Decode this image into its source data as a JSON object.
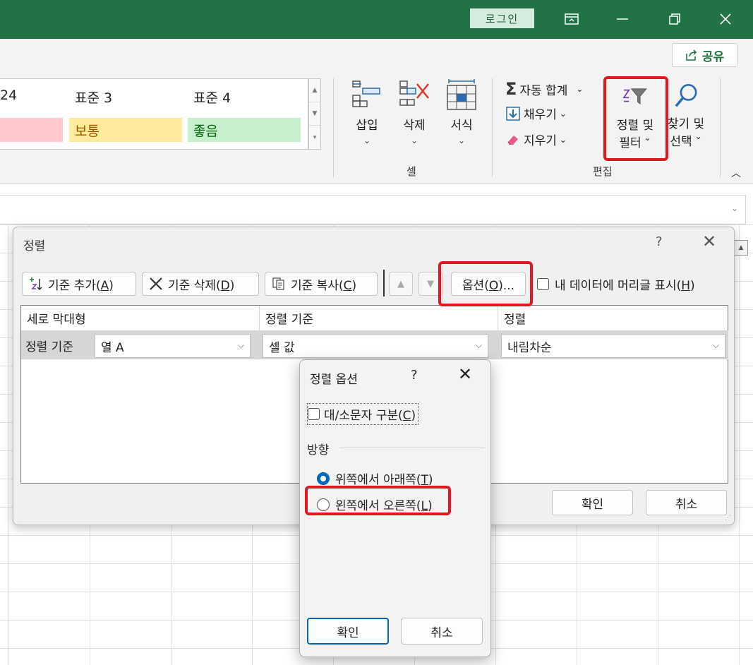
{
  "titlebar": {
    "login_label": "로그인",
    "icons": [
      "ribbon-display-icon",
      "minimize-icon",
      "restore-icon",
      "close-icon"
    ]
  },
  "ribbon": {
    "share_label": "공유",
    "styles": [
      {
        "name": "24",
        "cell": "",
        "bg": "#ffc7ce",
        "fg": "#9c0006"
      },
      {
        "name": "표준 3",
        "cell": "보통",
        "bg": "#ffeb9c",
        "fg": "#9c5700"
      },
      {
        "name": "표준 4",
        "cell": "좋음",
        "bg": "#c6efce",
        "fg": "#006100"
      }
    ],
    "cells_group": {
      "insert_label": "삽입",
      "delete_label": "삭제",
      "format_label": "서식",
      "group_label": "셀"
    },
    "editing_group": {
      "autosum_label": "자동 합계",
      "fill_label": "채우기",
      "clear_label": "지우기",
      "sort_filter_line1": "정렬 및",
      "sort_filter_line2": "필터",
      "find_select_line1": "찾기 및",
      "find_select_line2": "선택",
      "group_label": "편집"
    }
  },
  "sort_dialog": {
    "title": "정렬",
    "help": "?",
    "close": "✕",
    "add_level": "기준 추가(",
    "add_level_key": "A",
    "delete_level": "기준 삭제(",
    "delete_level_key": "D",
    "copy_level": "기준 복사(",
    "copy_level_key": "C",
    "options": "옵션(",
    "options_key": "O",
    "options_suffix": ")...",
    "has_headers": "내 데이터에 머리글 표시(",
    "has_headers_key": "H",
    "headers": {
      "column": "세로 막대형",
      "sort_on": "정렬 기준",
      "order": "정렬"
    },
    "row": {
      "label": "정렬 기준",
      "column": "열 A",
      "sort_on": "셀 값",
      "order": "내림차순"
    },
    "ok": "확인",
    "cancel": "취소"
  },
  "options_dialog": {
    "title": "정렬 옵션",
    "help": "?",
    "close": "✕",
    "case_sensitive": "대/소문자 구분(",
    "case_sensitive_key": "C",
    "orientation_label": "방향",
    "top_to_bottom": "위쪽에서 아래쪽(",
    "top_to_bottom_key": "T",
    "left_to_right": "왼쪽에서 오른쪽(",
    "left_to_right_key": "L",
    "selected": "top_to_bottom",
    "ok": "확인",
    "cancel": "취소"
  },
  "colors": {
    "excel_green": "#217346",
    "highlight_red": "#e0181f",
    "accent_blue": "#0067c0"
  }
}
